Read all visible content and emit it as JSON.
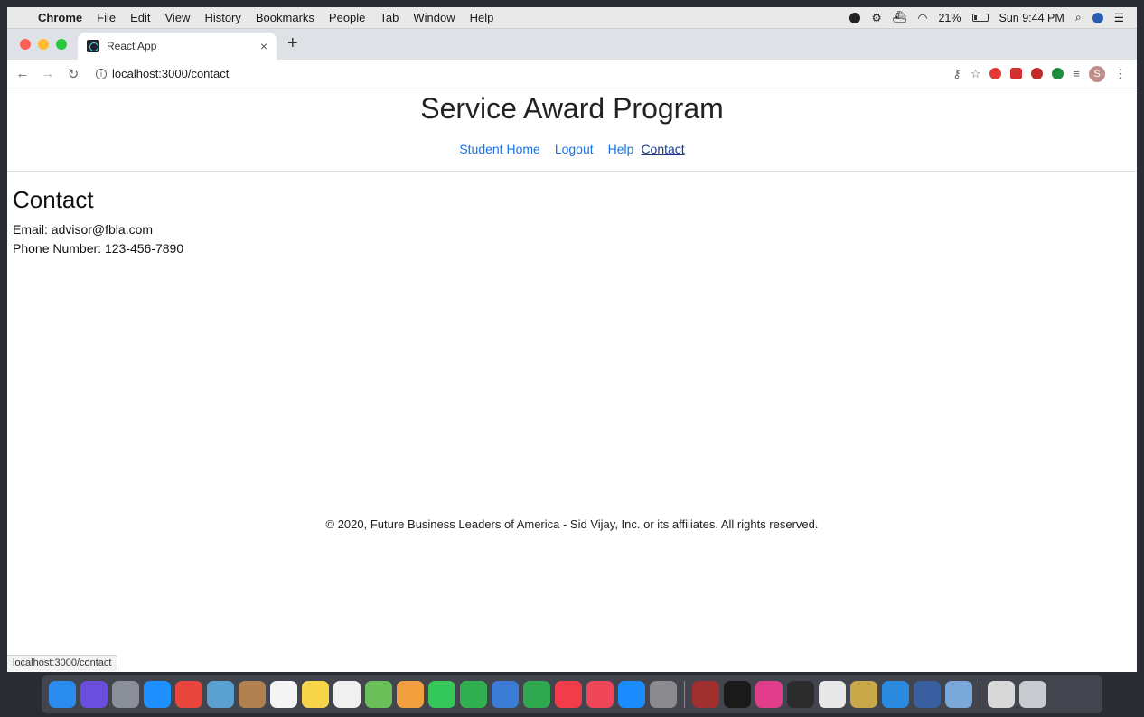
{
  "menubar": {
    "app_name": "Chrome",
    "menus": [
      "File",
      "Edit",
      "View",
      "History",
      "Bookmarks",
      "People",
      "Tab",
      "Window",
      "Help"
    ],
    "battery": "21%",
    "clock": "Sun 9:44 PM"
  },
  "browser": {
    "tab_title": "React App",
    "tab_close": "×",
    "new_tab": "+",
    "url": "localhost:3000/contact",
    "profile_initial": "S",
    "status_url": "localhost:3000/contact"
  },
  "site": {
    "title": "Service Award Program",
    "nav": [
      "Student Home",
      "Logout",
      "Help",
      "Contact"
    ]
  },
  "contact": {
    "heading": "Contact",
    "email": "Email: advisor@fbla.com",
    "phone": "Phone Number: 123-456-7890"
  },
  "footer": {
    "text": "© 2020, Future Business Leaders of America - Sid Vijay, Inc. or its affiliates. All rights reserved."
  },
  "dock": {
    "icons": [
      {
        "name": "finder-icon",
        "color": "#2b8cf0"
      },
      {
        "name": "siri-icon",
        "color": "#6a4ee0"
      },
      {
        "name": "launchpad-icon",
        "color": "#8a8f99"
      },
      {
        "name": "safari-icon",
        "color": "#1e90ff"
      },
      {
        "name": "chrome-icon",
        "color": "#e8453c"
      },
      {
        "name": "photos-app-icon",
        "color": "#5aa0d0"
      },
      {
        "name": "contacts-icon",
        "color": "#b08050"
      },
      {
        "name": "calendar-icon",
        "color": "#f4f4f4"
      },
      {
        "name": "notes-icon",
        "color": "#f7d54a"
      },
      {
        "name": "reminders-icon",
        "color": "#f0f0f0"
      },
      {
        "name": "maps-icon",
        "color": "#6bbf59"
      },
      {
        "name": "photos-icon",
        "color": "#f2a03d"
      },
      {
        "name": "messages-icon",
        "color": "#34c759"
      },
      {
        "name": "facetime-icon",
        "color": "#30b050"
      },
      {
        "name": "keynote-icon",
        "color": "#3a7bd5"
      },
      {
        "name": "numbers-icon",
        "color": "#2fa84f"
      },
      {
        "name": "news-icon",
        "color": "#f23c4a"
      },
      {
        "name": "music-icon",
        "color": "#f0465a"
      },
      {
        "name": "app-store-icon",
        "color": "#1a8cff"
      },
      {
        "name": "system-preferences-icon",
        "color": "#8a8a8f"
      },
      {
        "name": "dictionary-icon",
        "color": "#a03030"
      },
      {
        "name": "terminal-icon",
        "color": "#1a1a1a"
      },
      {
        "name": "intellij-icon",
        "color": "#e03e8a"
      },
      {
        "name": "activity-monitor-icon",
        "color": "#2c2c2c"
      },
      {
        "name": "textedit-icon",
        "color": "#e8e8e8"
      },
      {
        "name": "keychain-icon",
        "color": "#c9a84a"
      },
      {
        "name": "vscode-icon",
        "color": "#2a8ae0"
      },
      {
        "name": "quicktime-icon",
        "color": "#3a5fa0"
      },
      {
        "name": "preview-icon",
        "color": "#7aa8d8"
      },
      {
        "name": "finder-window-icon",
        "color": "#d8d8d8"
      },
      {
        "name": "trash-icon",
        "color": "#c8ccd0"
      }
    ]
  }
}
